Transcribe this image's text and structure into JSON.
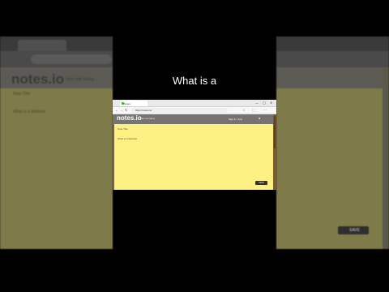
{
  "caption": "What is a",
  "browser": {
    "tab_title": "Notes",
    "address": "https://notes.io/",
    "win_min": "—",
    "win_max": "▢",
    "win_close": "✕"
  },
  "site": {
    "logo": "notes.io",
    "tagline": "fast note taking",
    "header_link": "Sign in / Join",
    "note_title": "Note Title",
    "note_text": "What is a Website",
    "save_label": "SAVE"
  },
  "background": {
    "logo": "notes.io",
    "tagline": "fast note taking",
    "note_title": "Note Title",
    "note_text": "What is a Website",
    "save_label": "SAVE"
  }
}
